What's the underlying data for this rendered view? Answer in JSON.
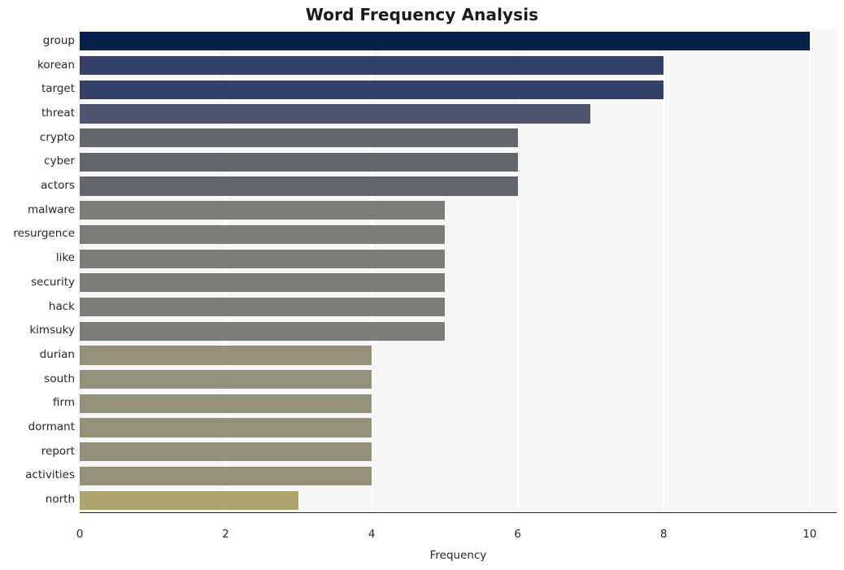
{
  "chart_data": {
    "type": "bar",
    "orientation": "horizontal",
    "title": "Word Frequency Analysis",
    "xlabel": "Frequency",
    "ylabel": "",
    "categories": [
      "group",
      "korean",
      "target",
      "threat",
      "crypto",
      "cyber",
      "actors",
      "malware",
      "resurgence",
      "like",
      "security",
      "hack",
      "kimsuky",
      "durian",
      "south",
      "firm",
      "dormant",
      "report",
      "activities",
      "north"
    ],
    "values": [
      10,
      8,
      8,
      7,
      6,
      6,
      6,
      5,
      5,
      5,
      5,
      5,
      5,
      4,
      4,
      4,
      4,
      4,
      4,
      3
    ],
    "bar_colors": [
      "#06224a",
      "#344269",
      "#344269",
      "#4d566e",
      "#64666e",
      "#64666e",
      "#64666e",
      "#7d7c79",
      "#7d7c79",
      "#7d7c79",
      "#7d7c79",
      "#7d7c79",
      "#7d7c79",
      "#95907a",
      "#95907a",
      "#95907a",
      "#95907a",
      "#95907a",
      "#95907a",
      "#ada36f"
    ],
    "xlim": [
      0,
      10.37
    ],
    "xticks": [
      0,
      2,
      4,
      6,
      8,
      10
    ],
    "xtick_labels": [
      "0",
      "2",
      "4",
      "6",
      "8",
      "10"
    ],
    "grid": "vertical-only",
    "grid_color": "#ffffff",
    "plot_background": "#f7f7f7",
    "figure_background": "#ffffff",
    "legend": "none"
  }
}
